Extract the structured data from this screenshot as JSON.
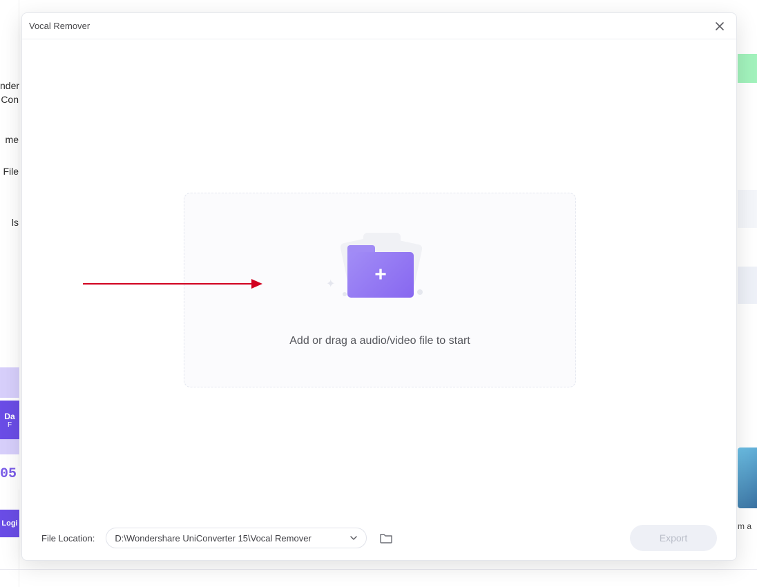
{
  "modal": {
    "title": "Vocal Remover",
    "dropzone_text": "Add or drag a audio/video file to start"
  },
  "footer": {
    "location_label": "File Location:",
    "path_value": "D:\\Wondershare UniConverter 15\\Vocal Remover",
    "export_label": "Export"
  },
  "background": {
    "left_items": [
      "nder",
      "Con",
      "me",
      "File",
      "ls"
    ],
    "badge_day": "Da",
    "badge_sub": "F",
    "login_text": "Logi",
    "digits": "05",
    "right_text": "m a"
  }
}
